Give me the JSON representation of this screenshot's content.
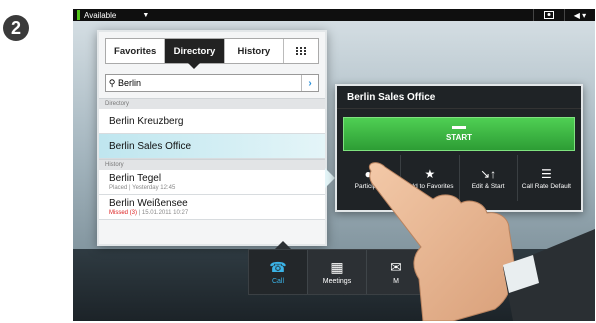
{
  "step": "2",
  "topbar": {
    "status": "Available",
    "icons": [
      "status-indicator",
      "selfview-icon",
      "volume-icon"
    ]
  },
  "tabs": [
    {
      "label": "Favorites"
    },
    {
      "label": "Directory",
      "active": true
    },
    {
      "label": "History"
    },
    {
      "label": "",
      "icon": "keypad-icon"
    }
  ],
  "search": {
    "value": "Berlin"
  },
  "directory": {
    "header": "Directory",
    "items": [
      {
        "title": "Berlin Kreuzberg"
      },
      {
        "title": "Berlin Sales Office",
        "selected": true
      }
    ]
  },
  "history": {
    "header": "History",
    "items": [
      {
        "title": "Berlin Tegel",
        "sub": "Placed | Yesterday 12:45"
      },
      {
        "title": "Berlin Weißensee",
        "missed": "Missed (3)",
        "sub": " | 15.01.2011 10:27"
      }
    ]
  },
  "contact": {
    "title": "Berlin Sales Office",
    "start_label": "START",
    "actions": [
      {
        "label": "Participants",
        "icon": "add-participant-icon"
      },
      {
        "label": "Add to Favorites",
        "icon": "star-icon"
      },
      {
        "label": "Edit & Start",
        "icon": "edit-icon"
      },
      {
        "label": "Call Rate Default",
        "icon": "menu-icon"
      }
    ]
  },
  "dock": [
    {
      "label": "Call",
      "icon": "call-icon",
      "active": true
    },
    {
      "label": "Meetings",
      "icon": "calendar-icon"
    },
    {
      "label": "M",
      "icon": "messages-icon"
    }
  ],
  "colors": {
    "accent": "#3bb4e8",
    "start_green": "#3cb444"
  }
}
